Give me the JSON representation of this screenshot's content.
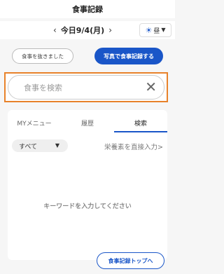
{
  "header": {
    "title": "食事記録"
  },
  "date_nav": {
    "prev_icon": "chevron-left-icon",
    "date": "今日9/4(月)",
    "next_icon": "chevron-right-icon"
  },
  "meal_select": {
    "icon": "sun-icon",
    "value": "昼"
  },
  "actions": {
    "skip_label": "食事を抜きました",
    "photo_label": "写真で食事記録する"
  },
  "search": {
    "placeholder": "食事を検索"
  },
  "tabs": [
    "MYメニュー",
    "履歴",
    "検索"
  ],
  "active_tab": "検索",
  "filter": {
    "value": "すべて"
  },
  "nutrient_link": "栄養素を直接入力>",
  "empty_message": "キーワードを入力してください",
  "footer": {
    "top_label": "食事記録トップへ"
  },
  "colors": {
    "accent": "#1a56c8",
    "highlight": "#e8822a"
  }
}
